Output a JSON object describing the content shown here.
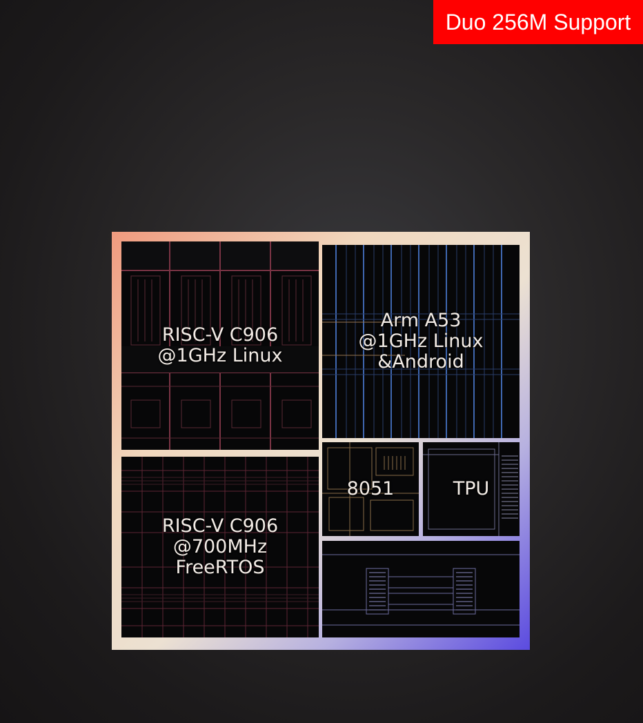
{
  "badge": {
    "text": "Duo 256M Support"
  },
  "chip": {
    "blocks": {
      "riscv_big": "RISC-V C906\n@1GHz Linux",
      "arm": "Arm A53\n@1GHz Linux\n&Android",
      "riscv_small": "RISC-V C906\n@700MHz\nFreeRTOS",
      "mcu": "8051",
      "tpu": "TPU",
      "bottom": ""
    }
  },
  "colors": {
    "badge": "#ff0000",
    "riscv_big_lines": "#8a3a4a",
    "arm_lines": "#4a78c8",
    "riscv_small_lines": "#7a3040",
    "mcu_lines": "#9a7a50",
    "tpu_lines": "#9a9ab8",
    "bottom_lines": "#8a88c0"
  }
}
